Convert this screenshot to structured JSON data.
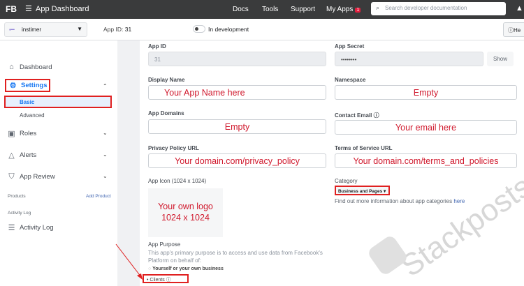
{
  "topbar": {
    "logo": "FB",
    "menu_icon": "hamburger-icon",
    "title": "App Dashboard",
    "links": [
      "Docs",
      "Tools",
      "Support",
      "My Apps"
    ],
    "my_apps_badge": "1",
    "search_placeholder": "Search developer documentation"
  },
  "subbar": {
    "app_name": "instimer",
    "app_id_label": "App ID:",
    "app_id_value": "31",
    "status": "In development",
    "help": "He"
  },
  "sidebar": {
    "items": [
      {
        "label": "Dashboard"
      },
      {
        "label": "Settings"
      },
      {
        "label": "Basic"
      },
      {
        "label": "Advanced"
      },
      {
        "label": "Roles"
      },
      {
        "label": "Alerts"
      },
      {
        "label": "App Review"
      }
    ],
    "products": "Products",
    "add_product": "Add Product",
    "activity_heading": "Activity Log",
    "activity": "Activity Log"
  },
  "form": {
    "app_id": {
      "label": "App ID",
      "value": "31"
    },
    "app_secret": {
      "label": "App Secret",
      "value": "••••••••",
      "show": "Show"
    },
    "display_name": {
      "label": "Display Name",
      "value": "Your App Name here"
    },
    "namespace": {
      "label": "Namespace",
      "value": "Empty"
    },
    "app_domains": {
      "label": "App Domains",
      "value": "Empty"
    },
    "contact_email": {
      "label": "Contact Email",
      "value": "Your email here"
    },
    "privacy": {
      "label": "Privacy Policy URL",
      "value": "Your domain.com/privacy_policy"
    },
    "terms": {
      "label": "Terms of Service URL",
      "value": "Your domain.com/terms_and_policies"
    },
    "icon": {
      "label": "App Icon (1024 x 1024)",
      "line1": "Your own logo",
      "line2": "1024 x 1024"
    },
    "category": {
      "label": "Category",
      "value": "Business and Pages",
      "info": "Find out more information about app categories",
      "link": "here"
    },
    "purpose": {
      "label": "App Purpose",
      "desc": "This app's primary purpose is to access and use data from Facebook's Platform on behalf of:",
      "options": [
        "Yourself or your own business",
        "Clients"
      ]
    }
  },
  "watermark": "Stackposts",
  "colors": {
    "accent": "#1877f2",
    "annotation": "#d0192d"
  }
}
